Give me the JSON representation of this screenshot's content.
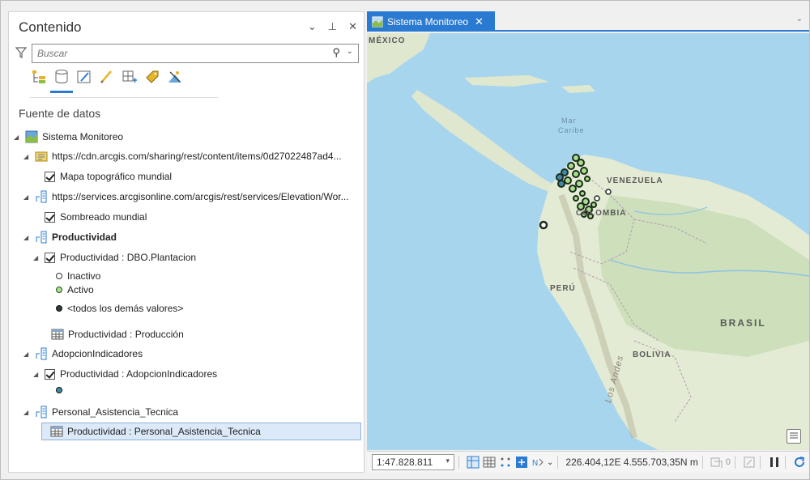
{
  "contents_pane": {
    "title": "Contenido",
    "controls": {
      "options": "⌄",
      "pin": "⊥",
      "close": "✕"
    },
    "search": {
      "placeholder": "Buscar"
    },
    "view_tabs": [
      "drawing-order",
      "data-source",
      "selection",
      "editing",
      "snapping",
      "labeling",
      "charts"
    ],
    "active_view": "data-source",
    "section_label": "Fuente de datos"
  },
  "tree": [
    {
      "label": "Sistema Monitoreo",
      "level": 0,
      "kind": "map"
    },
    {
      "label": "https://cdn.arcgis.com/sharing/rest/content/items/0d27022487ad4...",
      "level": 1,
      "kind": "vector-tile-source"
    },
    {
      "label": "Mapa topográfico mundial",
      "level": 2,
      "kind": "layer-checked"
    },
    {
      "label": "https://services.arcgisonline.com/arcgis/rest/services/Elevation/Wor...",
      "level": 1,
      "kind": "service"
    },
    {
      "label": "Sombreado mundial",
      "level": 2,
      "kind": "layer-checked"
    },
    {
      "label": "Productividad",
      "level": 1,
      "kind": "database",
      "bold": true
    },
    {
      "label": "Productividad : DBO.Plantacion",
      "level": 2,
      "kind": "layer-checked-expanded"
    },
    {
      "label": "Inactivo",
      "level": 3,
      "kind": "symbol",
      "color": "#ffffff"
    },
    {
      "label": "Activo",
      "level": 3,
      "kind": "symbol",
      "color": "#a7e08a"
    },
    {
      "label": "<todos los demás valores>",
      "level": 3,
      "kind": "symbol",
      "color": "#2f3b3b"
    },
    {
      "label": "Productividad : Producción",
      "level": 2,
      "kind": "table"
    },
    {
      "label": "AdopcionIndicadores",
      "level": 1,
      "kind": "database"
    },
    {
      "label": "Productividad : AdopcionIndicadores",
      "level": 2,
      "kind": "layer-checked-expanded"
    },
    {
      "label": "",
      "level": 3,
      "kind": "symbol",
      "color": "#3d8aa8"
    },
    {
      "label": "Personal_Asistencia_Tecnica",
      "level": 1,
      "kind": "database"
    },
    {
      "label": "Productividad : Personal_Asistencia_Tecnica",
      "level": 2,
      "kind": "table",
      "selected": true
    }
  ],
  "map_tab": {
    "title": "Sistema Monitoreo",
    "close": "✕",
    "menu": "⌄"
  },
  "map": {
    "labels": {
      "mexico": "MÉXICO",
      "mar_caribe_1": "Mar",
      "mar_caribe_2": "Caribe",
      "venezuela": "VENEZUELA",
      "colombia": "COLOMBIA",
      "peru": "PERÚ",
      "brasil": "BRASIL",
      "bolivia": "BOLIVIA",
      "andes": "Los Andes"
    },
    "colors": {
      "water": "#a8d5ee",
      "land": "#dfe8cf",
      "points_active": "#a7e08a",
      "points_outline": "#1d2b1d",
      "points_blue": "#3d8aa8"
    }
  },
  "status_bar": {
    "scale": "1:47.828.811",
    "coordinates": "226.404,12E 4.555.703,35N m",
    "selected_count": "0"
  }
}
